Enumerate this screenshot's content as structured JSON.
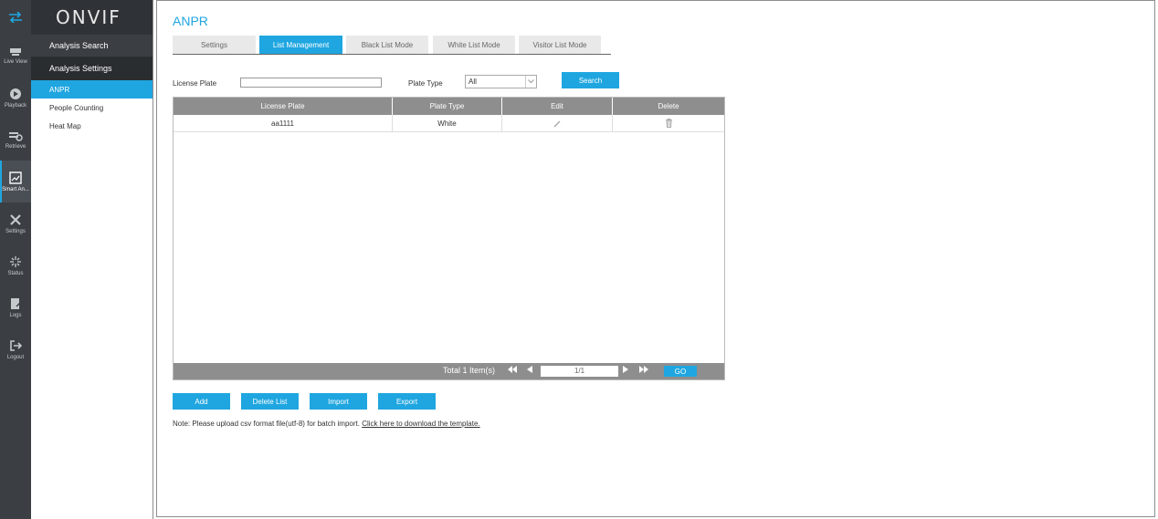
{
  "rail": {
    "items": [
      {
        "label": "Live View"
      },
      {
        "label": "Playback"
      },
      {
        "label": "Retrieve"
      },
      {
        "label": "Smart An..."
      },
      {
        "label": "Settings"
      },
      {
        "label": "Status"
      },
      {
        "label": "Logs"
      },
      {
        "label": "Logout"
      }
    ]
  },
  "logo": {
    "text": "ONVIF"
  },
  "submenu": {
    "sections": [
      {
        "label": "Analysis Search"
      },
      {
        "label": "Analysis Settings"
      }
    ],
    "items": [
      {
        "label": "ANPR"
      },
      {
        "label": "People Counting"
      },
      {
        "label": "Heat Map"
      }
    ]
  },
  "page": {
    "title": "ANPR",
    "tabs": [
      {
        "label": "Settings"
      },
      {
        "label": "List Management"
      },
      {
        "label": "Black List Mode"
      },
      {
        "label": "White List Mode"
      },
      {
        "label": "Visitor List Mode"
      }
    ],
    "active_tab": "List Management"
  },
  "filter": {
    "license_label": "License Plate",
    "license_value": "",
    "plate_type_label": "Plate Type",
    "plate_type_value": "All",
    "search_label": "Search"
  },
  "table": {
    "columns": [
      "License Plate",
      "Plate Type",
      "Edit",
      "Delete"
    ],
    "rows": [
      {
        "license_plate": "aa1111",
        "plate_type": "White"
      }
    ]
  },
  "pager": {
    "total": "Total 1 Item(s)",
    "page": "1/1",
    "go_label": "GO"
  },
  "actions": {
    "add": "Add",
    "delete_list": "Delete List",
    "import": "Import",
    "export": "Export"
  },
  "note": {
    "text": "Note: Please upload csv format file(utf-8) for batch import. ",
    "link": "Click here to download the template."
  },
  "colors": {
    "accent": "#1fa6e0",
    "rail": "#3b3f44",
    "header_gray": "#8e8e8e"
  }
}
